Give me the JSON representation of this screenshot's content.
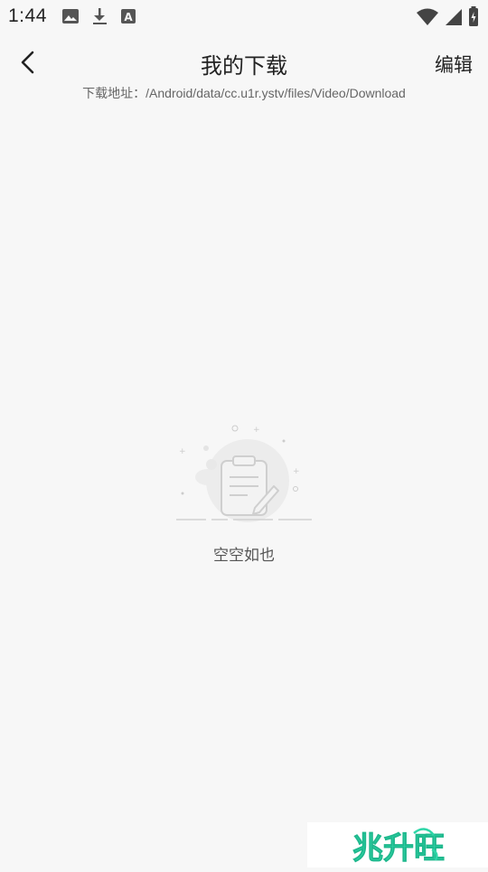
{
  "status_bar": {
    "time": "1:44",
    "left_icons": [
      "image-icon",
      "download-icon",
      "font-icon"
    ],
    "right_icons": [
      "wifi-icon",
      "signal-icon",
      "battery-icon"
    ]
  },
  "header": {
    "title": "我的下载",
    "edit_label": "编辑"
  },
  "download_path": {
    "label": "下载地址：",
    "value": "/Android/data/cc.u1r.ystv/files/Video/Download"
  },
  "empty_state": {
    "icon": "empty-clipboard-icon",
    "text": "空空如也"
  },
  "watermark": {
    "text": "兆升旺",
    "color": "#2fd6a8"
  }
}
